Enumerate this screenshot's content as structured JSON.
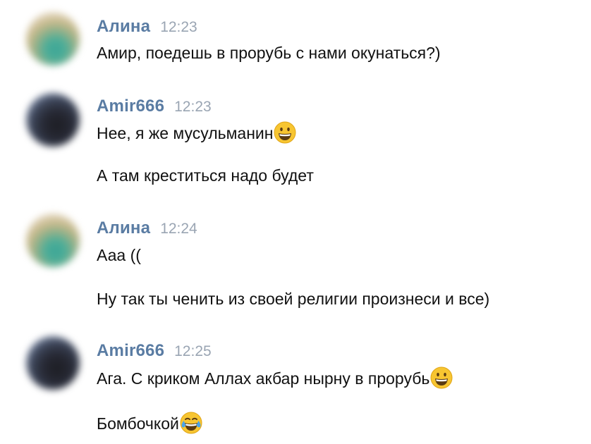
{
  "messages": [
    {
      "author": "Алина",
      "time": "12:23",
      "avatar_icon": "user-avatar-alina",
      "lines": [
        "Амир, поедешь в прорубь с нами окунаться?)"
      ]
    },
    {
      "author": "Amir666",
      "time": "12:23",
      "avatar_icon": "user-avatar-amir",
      "lines": [
        "Нее, я же мусульманин",
        "А там креститься надо будет"
      ],
      "emoji": [
        "grinning-face-icon",
        null
      ]
    },
    {
      "author": "Алина",
      "time": "12:24",
      "avatar_icon": "user-avatar-alina",
      "lines": [
        "Ааа ((",
        "Ну так ты ченить из своей религии произнеси и все)"
      ]
    },
    {
      "author": "Amir666",
      "time": "12:25",
      "avatar_icon": "user-avatar-amir",
      "lines": [
        "Ага. С криком Аллах акбар нырну в прорубь",
        "Бомбочкой"
      ],
      "emoji": [
        "grinning-face-icon",
        "tears-of-joy-icon"
      ]
    }
  ],
  "colors": {
    "author_name": "#5a7ca3",
    "timestamp": "#9aa5b3",
    "message_text": "#111111",
    "background": "#ffffff"
  }
}
